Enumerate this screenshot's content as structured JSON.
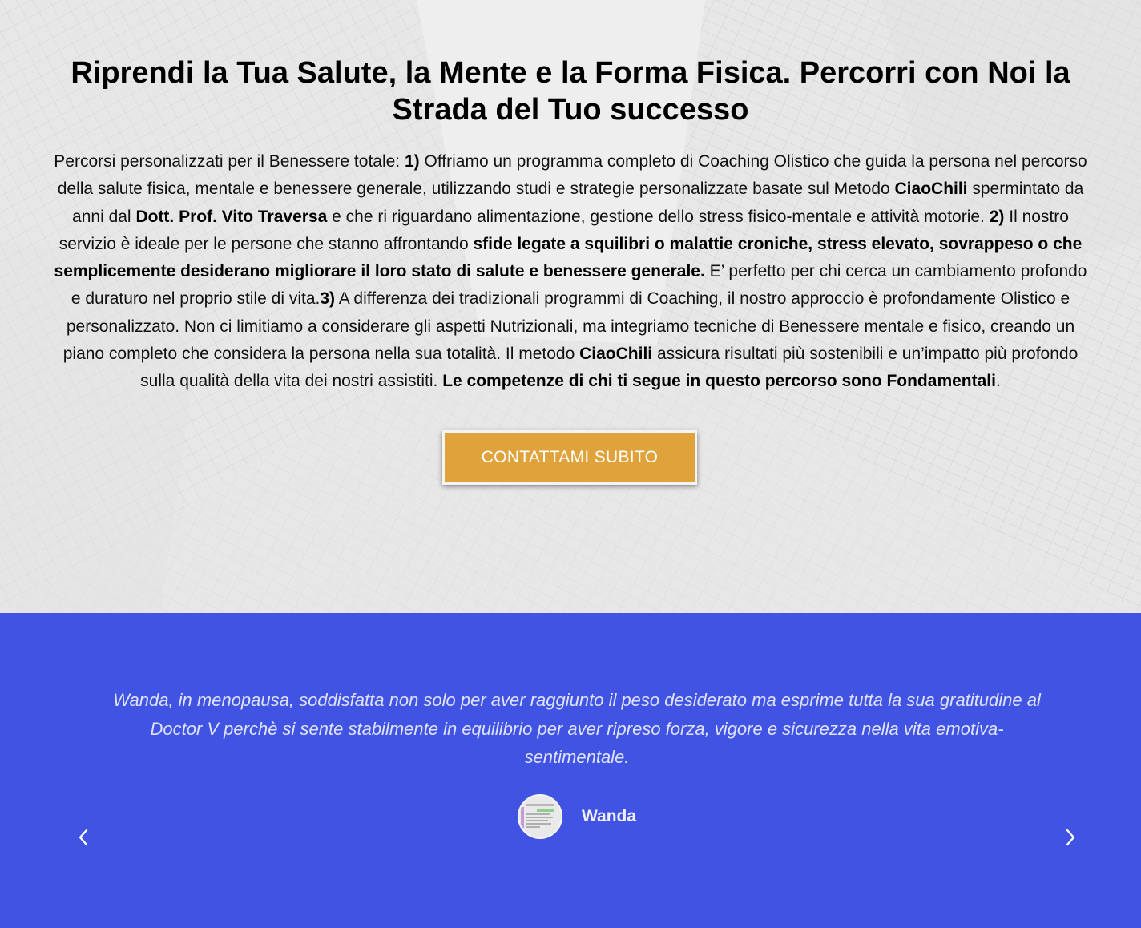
{
  "hero": {
    "title": "Riprendi la Tua Salute, la Mente e la Forma Fisica. Percorri con Noi la Strada del Tuo successo",
    "paragraph": [
      {
        "text": "Percorsi personalizzati per il Benessere totale: ",
        "bold": false
      },
      {
        "text": "1)",
        "bold": true
      },
      {
        "text": " Offriamo un programma completo di Coaching Olistico che guida la persona nel percorso della salute fisica, mentale e benessere generale, utilizzando studi e strategie personalizzate basate sul Metodo ",
        "bold": false
      },
      {
        "text": "CiaoChili",
        "bold": true
      },
      {
        "text": " spermintato da anni dal ",
        "bold": false
      },
      {
        "text": "Dott. Prof. Vito Traversa",
        "bold": true
      },
      {
        "text": " e che ri riguardano alimentazione, gestione dello stress fisico-mentale e  attività motorie. ",
        "bold": false
      },
      {
        "text": "2)",
        "bold": true
      },
      {
        "text": " Il nostro servizio è ideale per le persone che stanno affrontando ",
        "bold": false
      },
      {
        "text": "sfide legate a squilibri o malattie croniche, stress elevato, sovrappeso o che semplicemente desiderano migliorare il loro stato di salute e benessere generale.",
        "bold": true
      },
      {
        "text": " E’ perfetto per chi cerca un cambiamento profondo e duraturo nel proprio stile di vita.",
        "bold": false
      },
      {
        "text": "3)",
        "bold": true
      },
      {
        "text": " A differenza dei tradizionali programmi di Coaching, il nostro approccio è profondamente Olistico e personalizzato. Non ci limitiamo a considerare gli aspetti Nutrizionali, ma integriamo tecniche di Benessere mentale e fisico, creando un piano completo che considera la persona nella sua totalità. Il metodo ",
        "bold": false
      },
      {
        "text": "CiaoChili",
        "bold": true
      },
      {
        "text": " assicura risultati più sostenibili e un’impatto più profondo sulla qualità della vita dei nostri assistiti. ",
        "bold": false
      },
      {
        "text": "Le competenze di chi ti segue in questo percorso sono Fondamentali",
        "bold": true
      },
      {
        "text": ".",
        "bold": false
      }
    ],
    "cta_label": "CONTATTAMI SUBITO"
  },
  "testimonial": {
    "quote": "Wanda, in menopausa, soddisfatta non solo per aver raggiunto il peso desiderato ma esprime tutta la sua gratitudine al Doctor V perchè si sente stabilmente in equilibrio per aver ripreso forza, vigore e sicurezza nella vita emotiva- sentimentale.",
    "author": "Wanda",
    "prev_icon": "chevron-left-icon",
    "next_icon": "chevron-right-icon"
  },
  "colors": {
    "cta_background": "#e0a23b",
    "testimonial_background": "#4053e2"
  }
}
